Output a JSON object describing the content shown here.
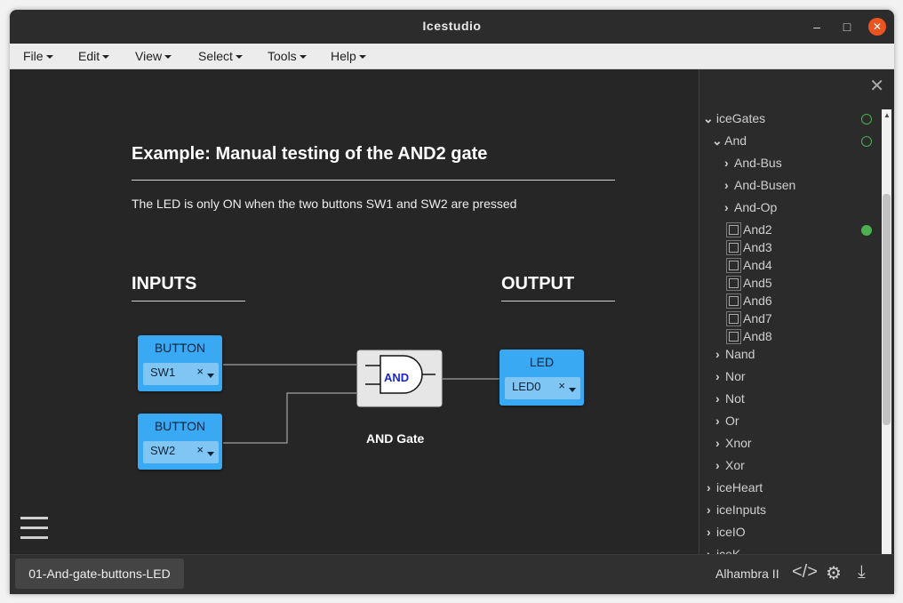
{
  "window": {
    "title": "Icestudio"
  },
  "menu": [
    {
      "label": "File"
    },
    {
      "label": "Edit"
    },
    {
      "label": "View"
    },
    {
      "label": "Select"
    },
    {
      "label": "Tools"
    },
    {
      "label": "Help"
    }
  ],
  "canvas": {
    "title": "Example: Manual testing of the AND2 gate",
    "description": "The LED is only ON when the two buttons SW1 and SW2 are pressed",
    "inputs_heading": "INPUTS",
    "output_heading": "OUTPUT",
    "button1": {
      "title": "BUTTON",
      "pin": "SW1",
      "clear": "×"
    },
    "button2": {
      "title": "BUTTON",
      "pin": "SW2",
      "clear": "×"
    },
    "led": {
      "title": "LED",
      "pin": "LED0",
      "clear": "×"
    },
    "gate": {
      "symbol_text": "AND",
      "label": "AND Gate"
    }
  },
  "sidebar": {
    "close": "✕",
    "tree": [
      {
        "label": "iceGates",
        "expanded": true,
        "status": "empty"
      },
      {
        "label": "And",
        "expanded": true,
        "status": "empty"
      },
      {
        "label": "And-Bus",
        "expanded": false
      },
      {
        "label": "And-Busen",
        "expanded": false
      },
      {
        "label": "And-Op",
        "expanded": false
      },
      {
        "label": "And2",
        "leaf": true,
        "status": "filled"
      },
      {
        "label": "And3",
        "leaf": true
      },
      {
        "label": "And4",
        "leaf": true
      },
      {
        "label": "And5",
        "leaf": true
      },
      {
        "label": "And6",
        "leaf": true
      },
      {
        "label": "And7",
        "leaf": true
      },
      {
        "label": "And8",
        "leaf": true
      },
      {
        "label": "Nand",
        "expanded": false
      },
      {
        "label": "Nor",
        "expanded": false
      },
      {
        "label": "Not",
        "expanded": false
      },
      {
        "label": "Or",
        "expanded": false
      },
      {
        "label": "Xnor",
        "expanded": false
      },
      {
        "label": "Xor",
        "expanded": false
      },
      {
        "label": "iceHeart",
        "expanded": false
      },
      {
        "label": "iceInputs",
        "expanded": false
      },
      {
        "label": "iceIO",
        "expanded": false
      },
      {
        "label": "iceK",
        "expanded": false
      }
    ]
  },
  "footer": {
    "file_tab": "01-And-gate-buttons-LED",
    "board": "Alhambra II"
  },
  "colors": {
    "block": "#3aa9f3",
    "status_green": "#4caf50",
    "accent_close": "#e95420"
  }
}
